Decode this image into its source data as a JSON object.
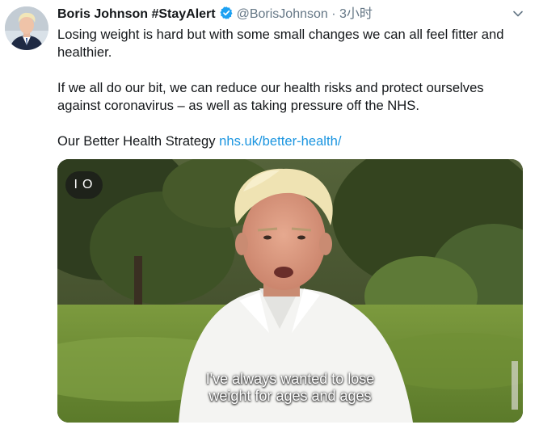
{
  "tweet": {
    "author_name": "Boris Johnson #StayAlert",
    "handle": "@BorisJohnson",
    "separator": "·",
    "time": "3小时",
    "verified_color": "#1da1f2",
    "paragraph1": "Losing weight is hard but with some small changes we can all feel fitter and healthier.",
    "paragraph2": "If we all do our bit, we can reduce our health risks and protect ourselves against coronavirus – as well as taking pressure off the NHS.",
    "paragraph3_prefix": "Our Better Health Strategy",
    "link_text": "nhs.uk/better-health/",
    "link_color": "#1b95e0"
  },
  "media": {
    "badge_text": "IO",
    "subtitle_line1": "I've always wanted to lose",
    "subtitle_line2": "weight for ages and ages"
  },
  "icons": {
    "verified": "verified-badge-icon",
    "caret": "chevron-down-icon"
  }
}
